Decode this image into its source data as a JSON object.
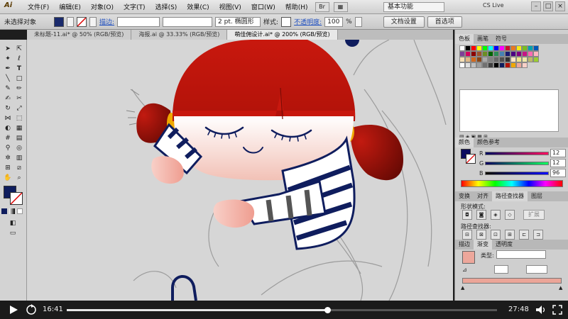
{
  "app": {
    "logo": "Ai"
  },
  "menu": [
    "文件(F)",
    "编辑(E)",
    "对象(O)",
    "文字(T)",
    "选择(S)",
    "效果(C)",
    "视图(V)",
    "窗口(W)",
    "帮助(H)"
  ],
  "workspace": "基本功能",
  "cslive": "CS Live",
  "window_buttons": [
    "–",
    "□",
    "×"
  ],
  "controlbar": {
    "selection_label": "未选择对象",
    "stroke_label": "描边:",
    "brush_label": "2 pt. 椭圆形",
    "style_label": "样式:",
    "opacity_label": "不透明度:",
    "opacity_value": "100",
    "opacity_unit": "%",
    "doc_setup_button": "文档设置",
    "prefs_button": "首选项",
    "fill_color": "#1a2a6c",
    "stroke_color": "#ffffff"
  },
  "tabs": [
    {
      "label": "未标题-11.ai* @ 50% (RGB/预览)",
      "active": false
    },
    {
      "label": "海报.ai @ 33.33% (RGB/预览)",
      "active": false
    },
    {
      "label": "萌佳佣设计.ai* @ 200% (RGB/预览)",
      "active": true
    }
  ],
  "panels": {
    "swatches_tabs": [
      "色板",
      "画笔",
      "符号"
    ],
    "color_tabs": [
      "颜色",
      "颜色参考"
    ],
    "color": {
      "r_label": "R",
      "g_label": "G",
      "b_label": "B",
      "r": "12",
      "g": "12",
      "b": "96",
      "fill": "#0c0c60"
    },
    "transform_tabs": [
      "变换",
      "对齐",
      "路径查找器",
      "图层"
    ],
    "shape_modes_label": "形状模式:",
    "expand_button": "扩展",
    "pathfinder_label": "路径查找器:",
    "stroke_tabs": [
      "描边",
      "渐变",
      "透明度"
    ],
    "gradient_type_label": "类型:"
  },
  "video": {
    "current_time": "16:41",
    "total_time": "27:48",
    "progress": 0.606
  }
}
